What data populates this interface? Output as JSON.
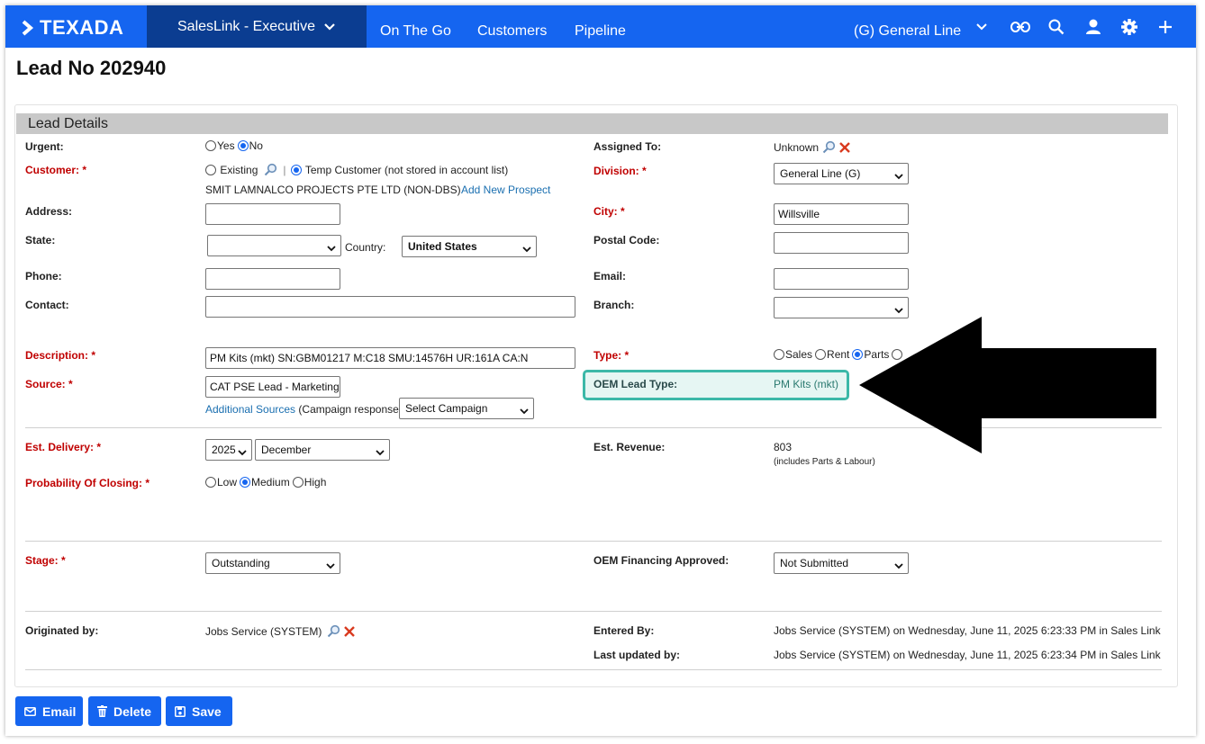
{
  "nav": {
    "logo": "TEXADA",
    "app": "SalesLink - Executive",
    "links": [
      "On The Go",
      "Customers",
      "Pipeline"
    ],
    "line": "(G) General Line"
  },
  "page": {
    "title": "Lead No 202940"
  },
  "section": {
    "title": "Lead Details"
  },
  "form": {
    "urgent": {
      "label": "Urgent:",
      "opt_yes": "Yes",
      "opt_no": "No"
    },
    "customer": {
      "label": "Customer: *",
      "opt_existing": "Existing",
      "opt_temp": "Temp Customer (not stored in account list)",
      "name": "SMIT LAMNALCO PROJECTS PTE LTD (NON-DBS)",
      "add_prospect": "Add New Prospect"
    },
    "address": {
      "label": "Address:",
      "value": ""
    },
    "state": {
      "label": "State:",
      "value": ""
    },
    "country": {
      "label": "Country:",
      "value": "United States"
    },
    "phone": {
      "label": "Phone:",
      "value": ""
    },
    "contact": {
      "label": "Contact:",
      "value": ""
    },
    "description": {
      "label": "Description: *",
      "value": "PM Kits (mkt) SN:GBM01217 M:C18 SMU:14576H UR:161A CA:N"
    },
    "source": {
      "label": "Source: *",
      "value": "CAT PSE Lead - Marketing",
      "additional": "Additional Sources",
      "campaign_text": "(Campaign response)",
      "campaign_select": "Select Campaign"
    },
    "assigned_to": {
      "label": "Assigned To:",
      "value": "Unknown"
    },
    "division": {
      "label": "Division: *",
      "value": "General Line (G)"
    },
    "city": {
      "label": "City: *",
      "value": "Willsville"
    },
    "postal": {
      "label": "Postal Code:",
      "value": ""
    },
    "email": {
      "label": "Email:",
      "value": ""
    },
    "branch": {
      "label": "Branch:",
      "value": ""
    },
    "type": {
      "label": "Type: *",
      "opt_sales": "Sales",
      "opt_rent": "Rent",
      "opt_parts": "Parts"
    },
    "oem_lead_type": {
      "label": "OEM Lead Type:",
      "value": "PM Kits (mkt)"
    },
    "est_delivery": {
      "label": "Est. Delivery: *",
      "year": "2025",
      "month": "December"
    },
    "est_revenue": {
      "label": "Est. Revenue:",
      "value": "803",
      "note": "(includes Parts & Labour)"
    },
    "probability": {
      "label": "Probability Of Closing: *",
      "opt_low": "Low",
      "opt_medium": "Medium",
      "opt_high": "High"
    },
    "stage": {
      "label": "Stage: *",
      "value": "Outstanding"
    },
    "oem_financing": {
      "label": "OEM Financing Approved:",
      "value": "Not Submitted"
    },
    "originated_by": {
      "label": "Originated by:",
      "value": "Jobs Service (SYSTEM)"
    },
    "entered_by": {
      "label": "Entered By:",
      "value": "Jobs Service (SYSTEM) on Wednesday, June 11, 2025 6:23:33 PM in Sales Link"
    },
    "last_updated": {
      "label": "Last updated by:",
      "value": "Jobs Service (SYSTEM) on Wednesday, June 11, 2025 6:23:34 PM in Sales Link"
    }
  },
  "buttons": {
    "email": "Email",
    "delete": "Delete",
    "save": "Save"
  },
  "colors": {
    "nav": "#1565f0",
    "nav_dark": "#0b3d91",
    "required": "#c00000",
    "highlight_border": "#3cb8a8"
  }
}
